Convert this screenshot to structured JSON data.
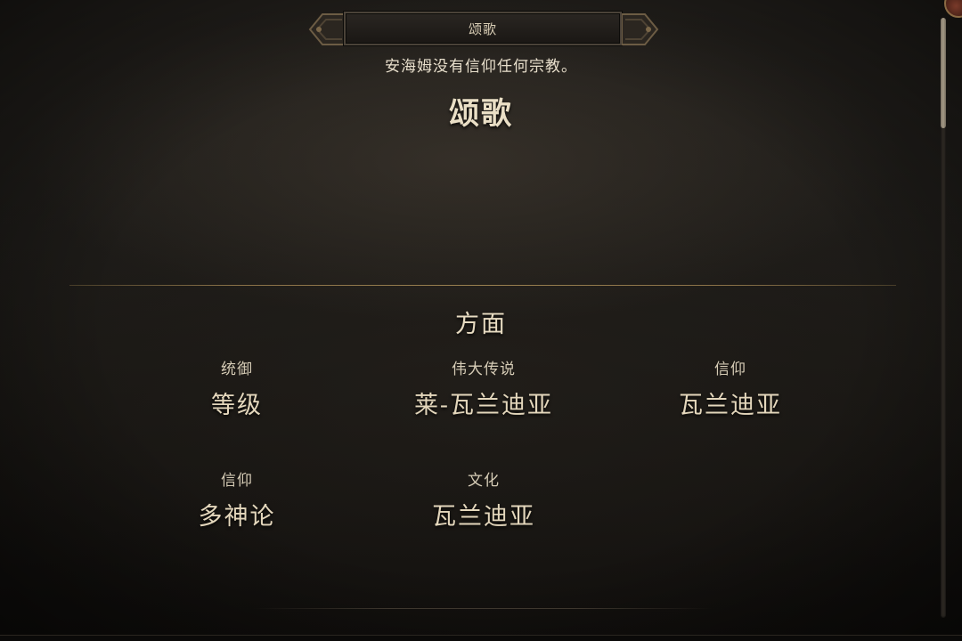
{
  "header": {
    "title": "颂歌"
  },
  "subtitle": "安海姆没有信仰任何宗教。",
  "main_title": "颂歌",
  "aspects": {
    "heading": "方面",
    "items": [
      {
        "label": "统御",
        "value": "等级"
      },
      {
        "label": "伟大传说",
        "value": "莱-瓦兰迪亚"
      },
      {
        "label": "信仰",
        "value": "瓦兰迪亚"
      },
      {
        "label": "信仰",
        "value": "多神论"
      },
      {
        "label": "文化",
        "value": "瓦兰迪亚"
      }
    ]
  },
  "scrollbar": {
    "position_fraction": 0.0
  },
  "colors": {
    "accent_gold": "#8a7248",
    "text_primary": "#e6dcc6",
    "background": "#1d1b18"
  }
}
